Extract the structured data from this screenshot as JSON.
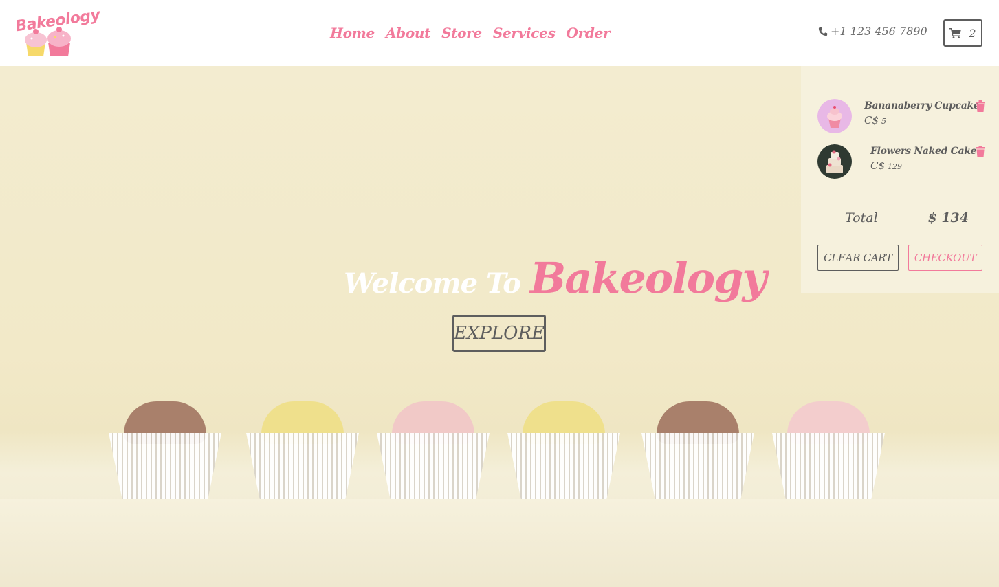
{
  "brand": {
    "name": "Bakeology",
    "accent_color": "#f27a9b"
  },
  "nav": {
    "items": [
      {
        "label": "Home"
      },
      {
        "label": "About"
      },
      {
        "label": "Store"
      },
      {
        "label": "Services"
      },
      {
        "label": "Order"
      }
    ]
  },
  "header": {
    "phone_icon": "phone-icon",
    "phone": "+1 123 456 7890",
    "cart_icon": "cart-icon",
    "cart_count": "2"
  },
  "hero": {
    "welcome": "Welcome To",
    "brand": "Bakeology",
    "explore_label": "EXPLORE"
  },
  "cart": {
    "items": [
      {
        "title": "Bananaberry Cupcake",
        "currency": "C$",
        "price": "5",
        "remove_icon": "trash-icon"
      },
      {
        "title": "Flowers Naked Cake",
        "currency": "C$",
        "price": "129",
        "remove_icon": "trash-icon"
      }
    ],
    "total_label": "Total",
    "total_value": "$ 134",
    "clear_label": "CLEAR CART",
    "checkout_label": "CHECKOUT"
  }
}
